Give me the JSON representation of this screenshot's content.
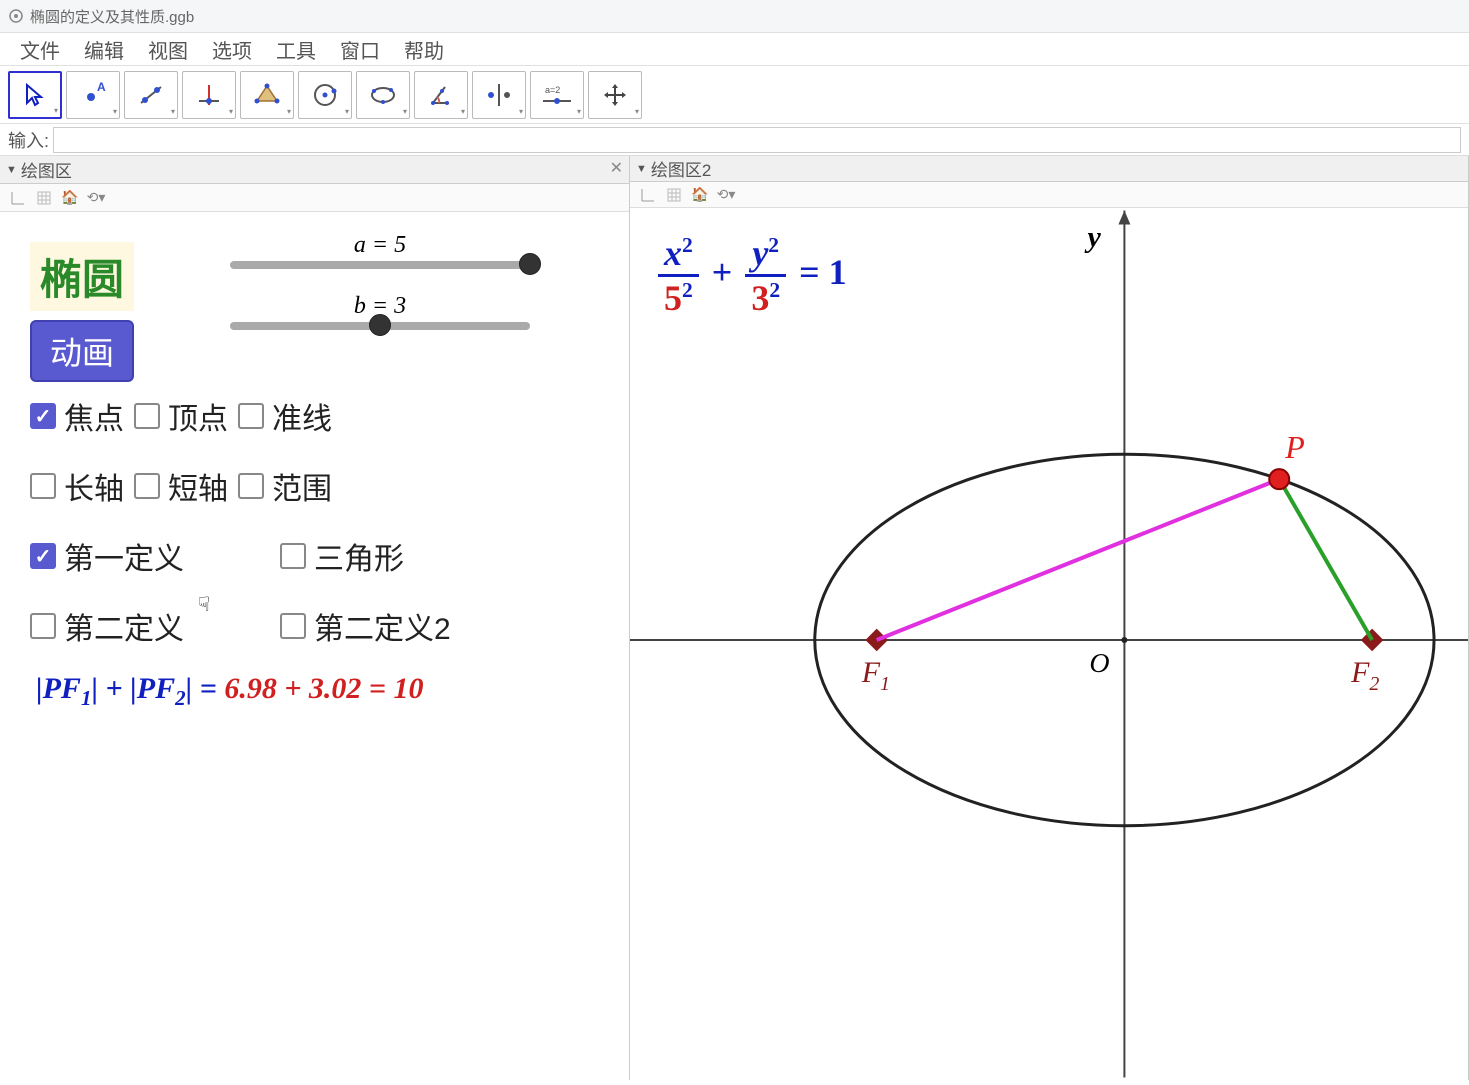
{
  "window": {
    "title": "椭圆的定义及其性质.ggb"
  },
  "menu": {
    "items": [
      "文件",
      "编辑",
      "视图",
      "选项",
      "工具",
      "窗口",
      "帮助"
    ]
  },
  "toolbar": {
    "icons": [
      "cursor",
      "point",
      "line",
      "perp",
      "poly",
      "circle",
      "conic",
      "angle",
      "reflect",
      "slider",
      "move"
    ]
  },
  "inputBar": {
    "label": "输入:",
    "value": ""
  },
  "panelLeft": {
    "title": "绘图区"
  },
  "panelRight": {
    "title": "绘图区2"
  },
  "ellipseLabel": "椭圆",
  "animButton": "动画",
  "sliders": {
    "a": {
      "label": "a = 5",
      "value": 5,
      "min": 0,
      "max": 5,
      "percent": 100
    },
    "b": {
      "label": "b = 3",
      "value": 3,
      "min": 0,
      "max": 6,
      "percent": 50
    }
  },
  "checkboxes": [
    {
      "label": "焦点",
      "checked": true
    },
    {
      "label": "顶点",
      "checked": false
    },
    {
      "label": "准线",
      "checked": false
    },
    {
      "label": "长轴",
      "checked": false
    },
    {
      "label": "短轴",
      "checked": false
    },
    {
      "label": "范围",
      "checked": false
    },
    {
      "label": "第一定义",
      "checked": true
    },
    {
      "label": "三角形",
      "checked": false
    },
    {
      "label": "第二定义",
      "checked": false
    },
    {
      "label": "第二定义2",
      "checked": false
    }
  ],
  "distanceEq": {
    "prefix": "|PF",
    "sub1": "1",
    "mid": "| + |PF",
    "sub2": "2",
    "suffix": "| = ",
    "d1": "6.98",
    "plus": " + ",
    "d2": "3.02",
    "eq": " = ",
    "sum": "10"
  },
  "formula": {
    "x_num_var": "x",
    "x_num_exp": "2",
    "x_den_base": "5",
    "x_den_exp": "2",
    "plus": " + ",
    "y_num_var": "y",
    "y_num_exp": "2",
    "y_den_base": "3",
    "y_den_exp": "2",
    "rhs": " = 1"
  },
  "labels": {
    "y": "y",
    "O": "O",
    "F1": "F",
    "F1sub": "1",
    "F2": "F",
    "F2sub": "2",
    "P": "P"
  },
  "chart_data": {
    "type": "line",
    "title": "椭圆 x²/5² + y²/3² = 1",
    "xlabel": "",
    "ylabel": "y",
    "xlim": [
      -7,
      8
    ],
    "ylim": [
      -6,
      6
    ],
    "ellipse": {
      "a": 5,
      "b": 3,
      "cx": 0,
      "cy": 0
    },
    "foci": [
      {
        "name": "F1",
        "x": -4,
        "y": 0
      },
      {
        "name": "F2",
        "x": 4,
        "y": 0
      }
    ],
    "point_P": {
      "x": 2.5,
      "y": 2.6
    },
    "series": [
      {
        "name": "PF1",
        "color": "#e030e0",
        "from": {
          "x": -4,
          "y": 0
        },
        "to": {
          "x": 2.5,
          "y": 2.6
        },
        "length": 6.98
      },
      {
        "name": "PF2",
        "color": "#2aa02a",
        "from": {
          "x": 4,
          "y": 0
        },
        "to": {
          "x": 2.5,
          "y": 2.6
        },
        "length": 3.02
      }
    ],
    "sum_distances": 10
  }
}
